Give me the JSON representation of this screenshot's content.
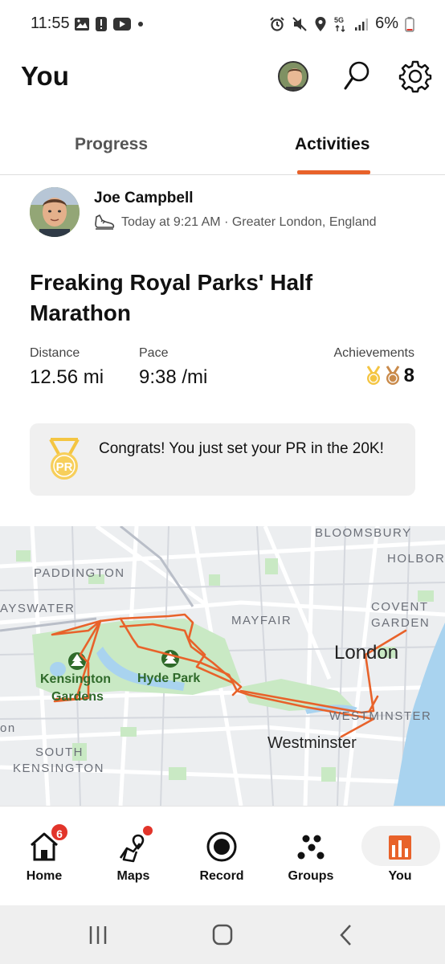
{
  "status_bar": {
    "time": "11:55",
    "battery": "6%"
  },
  "header": {
    "title": "You"
  },
  "tabs": [
    {
      "label": "Progress",
      "active": false
    },
    {
      "label": "Activities",
      "active": true
    }
  ],
  "activity": {
    "athlete_name": "Joe Campbell",
    "meta": "Today at 9:21 AM · Greater London, England",
    "title": "Freaking Royal Parks' Half Marathon",
    "stats": {
      "distance_label": "Distance",
      "distance_value": "12.56 mi",
      "pace_label": "Pace",
      "pace_value": "9:38 /mi",
      "achievements_label": "Achievements",
      "achievements_value": "8"
    },
    "pr_message": "Congrats! You just set your PR in the 20K!",
    "pr_badge": "PR"
  },
  "map": {
    "labels": {
      "bloomsbury": "BLOOMSBURY",
      "holborn": "HOLBORN",
      "paddington": "PADDINGTON",
      "bayswater": "AYSWATER",
      "mayfair": "MAYFAIR",
      "covent": "COVENT",
      "garden": "GARDEN",
      "london": "London",
      "kensington_gardens_1": "Kensington",
      "kensington_gardens_2": "Gardens",
      "hyde_park": "Hyde Park",
      "westminster_area": "WESTMINSTER",
      "westminster": "Westminster",
      "south": "SOUTH",
      "kensington": "KENSINGTON",
      "on": "on"
    },
    "route_color": "#e8622a"
  },
  "bottom_nav": [
    {
      "label": "Home",
      "badge": "6"
    },
    {
      "label": "Maps"
    },
    {
      "label": "Record"
    },
    {
      "label": "Groups"
    },
    {
      "label": "You",
      "active": true
    }
  ],
  "colors": {
    "accent": "#e8622a",
    "badge_red": "#e2342a",
    "pr_gold": "#f4c542"
  }
}
